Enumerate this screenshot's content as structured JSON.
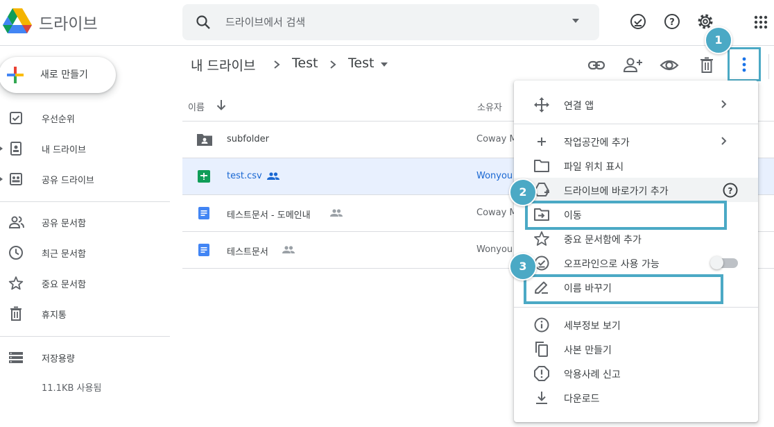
{
  "app": {
    "title": "드라이브"
  },
  "search": {
    "placeholder": "드라이브에서 검색"
  },
  "top_icons": [
    "offline-ready-icon",
    "help-icon",
    "settings-icon",
    "apps-grid-icon"
  ],
  "sidebar": {
    "new_label": "새로 만들기",
    "items": [
      {
        "label": "우선순위",
        "icon": "priority-icon"
      },
      {
        "label": "내 드라이브",
        "icon": "my-drive-icon"
      },
      {
        "label": "공유 드라이브",
        "icon": "shared-drives-icon"
      },
      {
        "label": "공유 문서함",
        "icon": "shared-with-me-icon"
      },
      {
        "label": "최근 문서함",
        "icon": "recent-icon"
      },
      {
        "label": "중요 문서함",
        "icon": "starred-icon"
      },
      {
        "label": "휴지통",
        "icon": "trash-icon"
      },
      {
        "label": "저장용량",
        "icon": "storage-icon"
      }
    ],
    "storage_used": "11.1KB 사용됨"
  },
  "breadcrumb": [
    "내 드라이브",
    "Test",
    "Test"
  ],
  "file_list": {
    "name_header": "이름",
    "owner_header": "소유자",
    "rows": [
      {
        "name": "subfolder",
        "owner": "Coway M",
        "type": "shared-folder",
        "shared": false,
        "selected": false
      },
      {
        "name": "test.csv",
        "owner": "Wonyou",
        "type": "sheets",
        "shared": true,
        "selected": true
      },
      {
        "name": "테스트문서 - 도메인내",
        "owner": "Coway M",
        "type": "docs",
        "shared": true,
        "selected": false
      },
      {
        "name": "테스트문서",
        "owner": "Wonyou",
        "type": "docs",
        "shared": true,
        "selected": false
      }
    ]
  },
  "context_menu": {
    "items": [
      {
        "label": "연결 앱",
        "icon": "move-arrows-icon",
        "submenu": true
      },
      {
        "label": "작업공간에 추가",
        "icon": "plus-icon",
        "submenu": true
      },
      {
        "label": "파일 위치 표시",
        "icon": "folder-icon"
      },
      {
        "label": "드라이브에 바로가기 추가",
        "icon": "drive-shortcut-icon",
        "help": true,
        "hovered": true
      },
      {
        "label": "이동",
        "icon": "move-to-folder-icon"
      },
      {
        "label": "중요 문서함에 추가",
        "icon": "star-icon"
      },
      {
        "label": "오프라인으로 사용 가능",
        "icon": "offline-icon",
        "toggle": false
      },
      {
        "label": "이름 바꾸기",
        "icon": "rename-pencil-icon"
      },
      {
        "label": "세부정보 보기",
        "icon": "info-icon"
      },
      {
        "label": "사본 만들기",
        "icon": "copy-icon"
      },
      {
        "label": "악용사례 신고",
        "icon": "report-icon"
      },
      {
        "label": "다운로드",
        "icon": "download-icon"
      }
    ]
  },
  "annotations": [
    "1",
    "2",
    "3"
  ],
  "colors": {
    "accent": "#4ba9c5",
    "selected_row": "#e8f0fe",
    "selected_text": "#1967d2",
    "icon": "#5f6368",
    "sheets_green": "#0f9d58",
    "docs_blue": "#4285f4"
  }
}
